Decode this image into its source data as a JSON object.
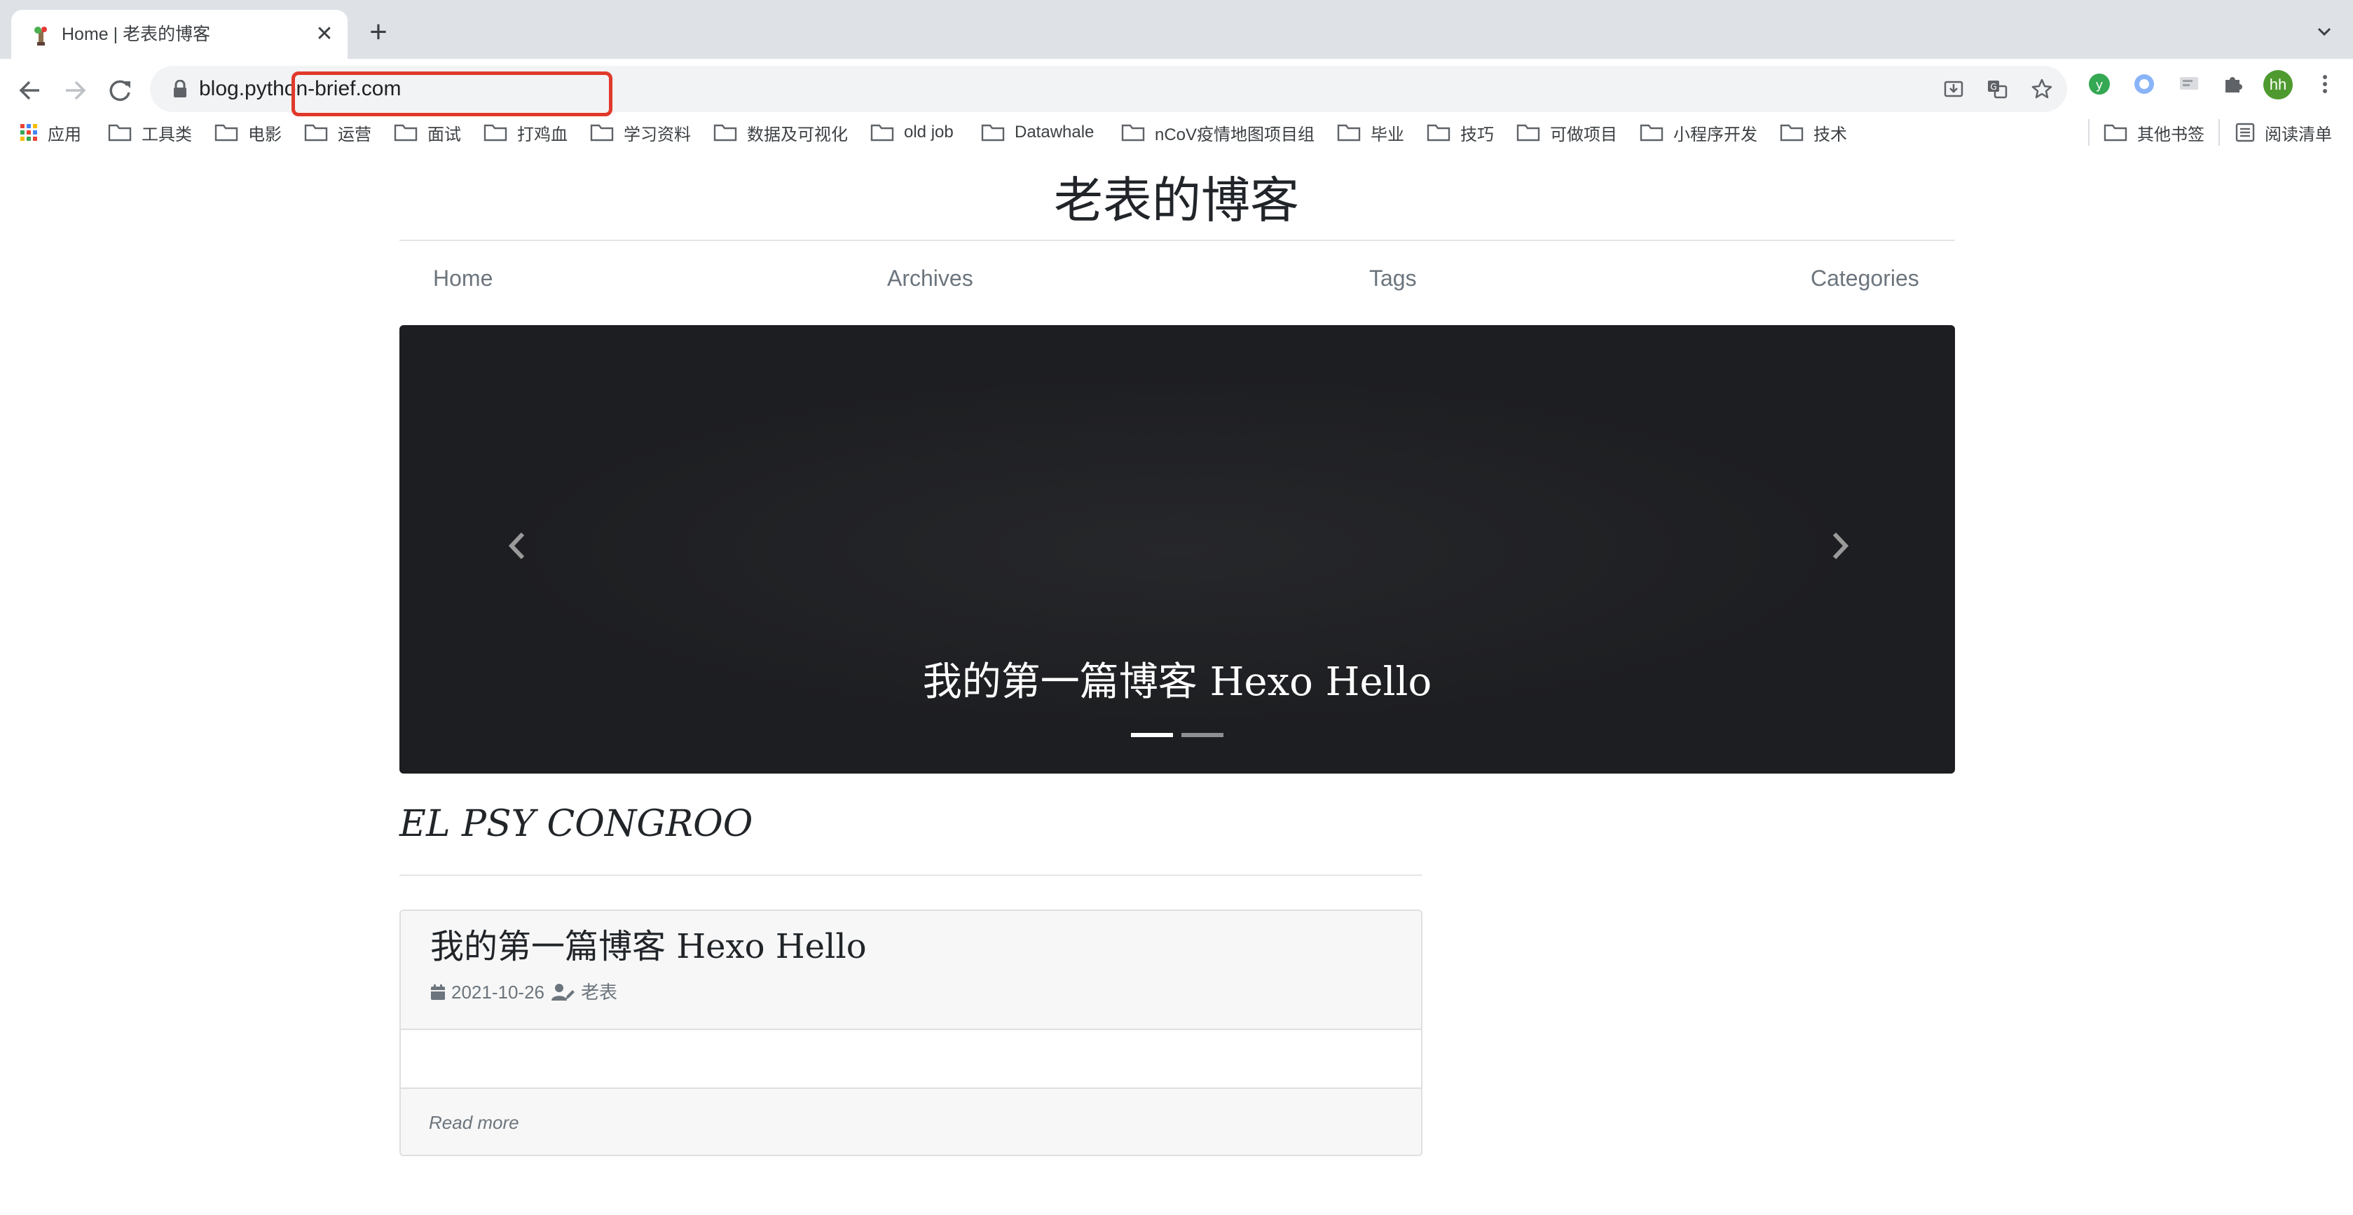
{
  "browser": {
    "tab": {
      "title": "Home | 老表的博客",
      "close_glyph": "✕"
    },
    "new_tab_glyph": "+",
    "url": "blog.python-brief.com",
    "profile_initials": "hh",
    "highlight_color": "#e0392b"
  },
  "bookmarks": {
    "apps_label": "应用",
    "folders": [
      "工具类",
      "电影",
      "运营",
      "面试",
      "打鸡血",
      "学习资料",
      "数据及可视化",
      "old job",
      "Datawhale",
      "nCoV疫情地图项目组",
      "毕业",
      "技巧",
      "可做项目",
      "小程序开发",
      "技术"
    ],
    "other_label": "其他书签",
    "reading_list_label": "阅读清单"
  },
  "site": {
    "title": "老表的博客",
    "nav": [
      "Home",
      "Archives",
      "Tags",
      "Categories"
    ]
  },
  "carousel": {
    "caption": "我的第一篇博客 Hexo Hello",
    "slide_count": 2,
    "active_slide": 1
  },
  "intro": "EL PSY CONGROO",
  "posts": [
    {
      "title": "我的第一篇博客 Hexo Hello",
      "date": "2021-10-26",
      "author": "老表",
      "read_more": "Read more"
    }
  ]
}
